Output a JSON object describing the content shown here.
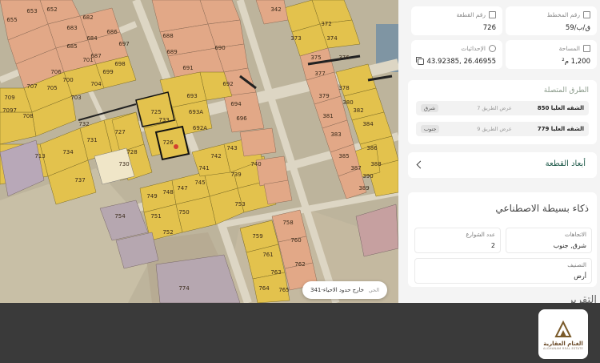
{
  "map": {
    "pill_label": "خارج حدود الاحياء-341",
    "pill_sub": "الحي",
    "plots": [
      {
        "n": "655"
      },
      {
        "n": "653"
      },
      {
        "n": "652"
      },
      {
        "n": "683"
      },
      {
        "n": "682"
      },
      {
        "n": "685"
      },
      {
        "n": "684"
      },
      {
        "n": "687"
      },
      {
        "n": "686"
      },
      {
        "n": "697"
      },
      {
        "n": "701"
      },
      {
        "n": "699"
      },
      {
        "n": "700"
      },
      {
        "n": "698"
      },
      {
        "n": "705"
      },
      {
        "n": "703"
      },
      {
        "n": "704"
      },
      {
        "n": "707"
      },
      {
        "n": "706"
      },
      {
        "n": "709"
      },
      {
        "n": "708"
      },
      {
        "n": "713"
      },
      {
        "n": "725"
      },
      {
        "n": "726"
      },
      {
        "n": "727"
      },
      {
        "n": "728"
      },
      {
        "n": "730"
      },
      {
        "n": "731"
      },
      {
        "n": "732"
      },
      {
        "n": "734"
      },
      {
        "n": "737"
      },
      {
        "n": "739"
      },
      {
        "n": "740"
      },
      {
        "n": "741"
      },
      {
        "n": "742"
      },
      {
        "n": "743"
      },
      {
        "n": "745"
      },
      {
        "n": "747"
      },
      {
        "n": "748"
      },
      {
        "n": "749"
      },
      {
        "n": "750"
      },
      {
        "n": "751"
      },
      {
        "n": "752"
      },
      {
        "n": "753"
      },
      {
        "n": "758"
      },
      {
        "n": "759"
      },
      {
        "n": "760"
      },
      {
        "n": "761"
      },
      {
        "n": "762"
      },
      {
        "n": "763"
      },
      {
        "n": "764"
      },
      {
        "n": "765"
      },
      {
        "n": "372"
      },
      {
        "n": "373"
      },
      {
        "n": "374"
      },
      {
        "n": "375"
      },
      {
        "n": "376"
      },
      {
        "n": "377"
      },
      {
        "n": "378"
      },
      {
        "n": "379"
      },
      {
        "n": "380"
      },
      {
        "n": "381"
      },
      {
        "n": "382"
      },
      {
        "n": "383"
      },
      {
        "n": "384"
      },
      {
        "n": "385"
      },
      {
        "n": "386"
      },
      {
        "n": "387"
      },
      {
        "n": "388"
      },
      {
        "n": "389"
      },
      {
        "n": "390"
      },
      {
        "n": "342"
      },
      {
        "n": "688"
      },
      {
        "n": "689"
      },
      {
        "n": "690"
      },
      {
        "n": "691"
      },
      {
        "n": "692"
      },
      {
        "n": "693"
      },
      {
        "n": "694"
      },
      {
        "n": "696"
      },
      {
        "n": "733"
      },
      {
        "n": "754"
      },
      {
        "n": "774"
      },
      {
        "n": "693A"
      },
      {
        "n": "692A"
      },
      {
        "n": "7097"
      }
    ]
  },
  "panel": {
    "plan_label": "رقم المخطط",
    "plan_value": "ق/ب/59",
    "plot_label": "رقم القطعة",
    "plot_value": "726",
    "area_label": "المساحة",
    "area_value": "1,200 م²",
    "coords_label": "الإحداثيات",
    "coords_value": "26.46955 ,43.92385",
    "roads_title": "الطرق المتصلة",
    "roads": [
      {
        "name": "الشقه العليا 850",
        "width": "عرض الطريق 7",
        "dir": "شرق"
      },
      {
        "name": "الشقه العليا 779",
        "width": "عرض الطريق 9",
        "dir": "جنوب"
      }
    ],
    "dims_title": "أبعاد القطعة",
    "ai_title": "ذكاء بسيطة الاصطناعي",
    "directions_label": "الاتجاهات",
    "directions_value": "شرق, جنوب",
    "streets_label": "عدد الشوارع",
    "streets_value": "2",
    "class_label": "التصنيف",
    "class_value": "أرض",
    "cut_heading": "التقرير"
  },
  "brand": {
    "logo_text": "الغنام العقارية",
    "logo_sub": "ALGHANAM REAL ESTATE"
  },
  "colors": {
    "plot_yellow": "#e6c24a",
    "plot_orange": "#e8a57a",
    "road": "#d8d2c0",
    "accent_green": "#1f5a4a"
  }
}
